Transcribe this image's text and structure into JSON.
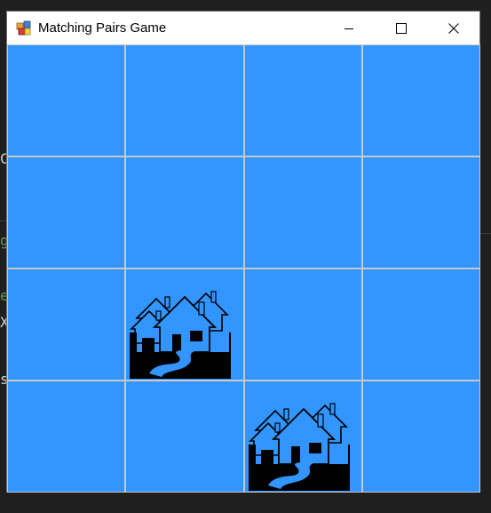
{
  "window": {
    "title": "Matching Pairs Game"
  },
  "titlebar_controls": [
    "minimize",
    "maximize",
    "close"
  ],
  "colors": {
    "tile_face_down": "#3395ff",
    "tile_border": "#c8c8c8",
    "icon_fill": "#000000"
  },
  "board": {
    "rows": 4,
    "cols": 4,
    "cells": [
      {
        "row": 1,
        "col": 1,
        "revealed": false
      },
      {
        "row": 1,
        "col": 2,
        "revealed": false
      },
      {
        "row": 1,
        "col": 3,
        "revealed": false
      },
      {
        "row": 1,
        "col": 4,
        "revealed": false
      },
      {
        "row": 2,
        "col": 1,
        "revealed": false
      },
      {
        "row": 2,
        "col": 2,
        "revealed": false
      },
      {
        "row": 2,
        "col": 3,
        "revealed": false
      },
      {
        "row": 2,
        "col": 4,
        "revealed": false
      },
      {
        "row": 3,
        "col": 1,
        "revealed": false
      },
      {
        "row": 3,
        "col": 2,
        "revealed": true,
        "icon": "village-icon"
      },
      {
        "row": 3,
        "col": 3,
        "revealed": false
      },
      {
        "row": 3,
        "col": 4,
        "revealed": false
      },
      {
        "row": 4,
        "col": 1,
        "revealed": false
      },
      {
        "row": 4,
        "col": 2,
        "revealed": false
      },
      {
        "row": 4,
        "col": 3,
        "revealed": true,
        "icon": "village-icon"
      },
      {
        "row": 4,
        "col": 4,
        "revealed": false
      }
    ]
  },
  "background_fragments": [
    {
      "text": "C",
      "color": "#d4d4d4"
    },
    {
      "text": "g",
      "color": "#6a9955"
    },
    {
      "text": "e",
      "color": "#6a9955"
    },
    {
      "text": "X",
      "color": "#d4d4d4"
    },
    {
      "text": "s",
      "color": "#d4d4d4"
    }
  ]
}
